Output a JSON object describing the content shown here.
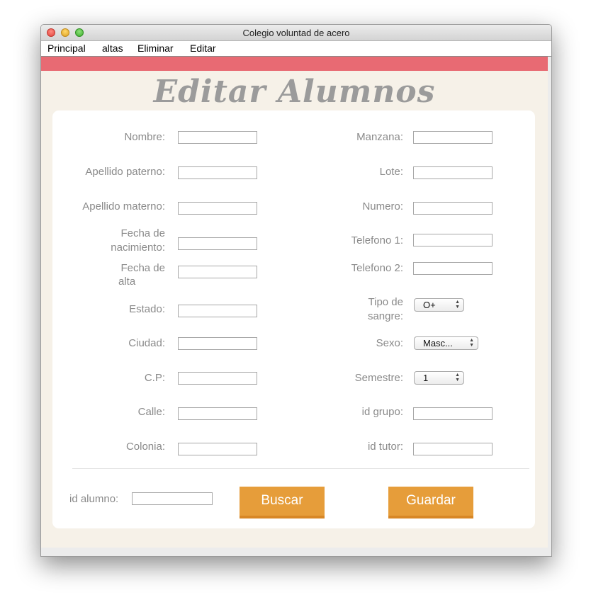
{
  "window": {
    "title": "Colegio voluntad de acero"
  },
  "menu": [
    "Principal",
    "altas",
    "Eliminar",
    "Editar"
  ],
  "heading": "Editar Alumnos",
  "colors": {
    "accent_bar": "#e86a73",
    "button": "#e69d3a",
    "background": "#f6f1e8"
  },
  "form": {
    "left": {
      "nombre": "Nombre:",
      "apellido_paterno": "Apellido paterno:",
      "apellido_materno": "Apellido materno:",
      "fecha_nac_1": "Fecha de",
      "fecha_nac_2": "nacimiento:",
      "fecha_alta_1": "Fecha de",
      "fecha_alta_2": "alta",
      "estado": "Estado:",
      "ciudad": "Ciudad:",
      "cp": "C.P:",
      "calle": "Calle:",
      "colonia": "Colonia:"
    },
    "right": {
      "manzana": "Manzana:",
      "lote": "Lote:",
      "numero": "Numero:",
      "telefono1": "Telefono 1:",
      "telefono2": "Telefono 2:",
      "tipo_sangre_1": "Tipo de",
      "tipo_sangre_2": "sangre:",
      "sexo": "Sexo:",
      "semestre": "Semestre:",
      "id_grupo": "id grupo:",
      "id_tutor": "id tutor:"
    },
    "selects": {
      "tipo_sangre": "O+",
      "sexo": "Masc...",
      "semestre": "1"
    },
    "values": {
      "nombre": "",
      "apellido_paterno": "",
      "apellido_materno": "",
      "fecha_nacimiento": "",
      "fecha_alta": "",
      "estado": "",
      "ciudad": "",
      "cp": "",
      "calle": "",
      "colonia": "",
      "manzana": "",
      "lote": "",
      "numero": "",
      "telefono1": "",
      "telefono2": "",
      "id_grupo": "",
      "id_tutor": "",
      "id_alumno": ""
    }
  },
  "footer": {
    "id_alumno_label": "id alumno:",
    "buscar": "Buscar",
    "guardar": "Guardar"
  }
}
